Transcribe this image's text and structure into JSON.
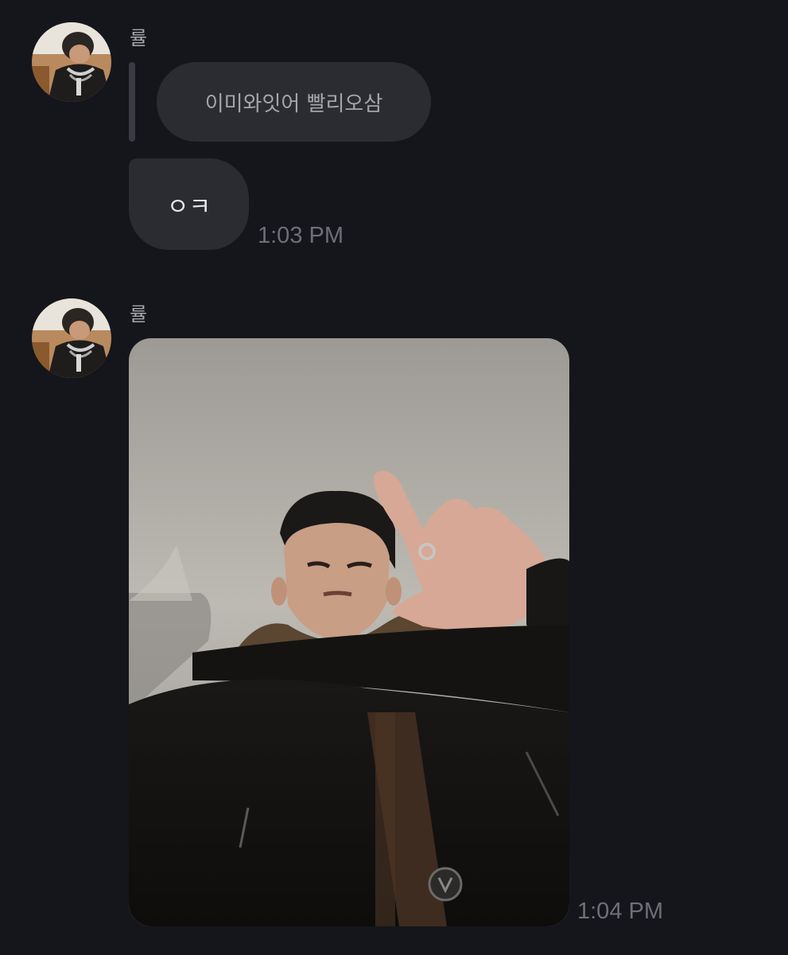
{
  "messages": [
    {
      "sender": "률",
      "avatar_icon": "profile-photo-avatar",
      "quoted_text": "이미와잇어 빨리오삼",
      "text": "ㅇㅋ",
      "time": "1:03 PM"
    },
    {
      "sender": "률",
      "avatar_icon": "profile-photo-avatar",
      "attachment": "photo",
      "time": "1:04 PM"
    }
  ],
  "colors": {
    "background": "#15161b",
    "bubble": "#2b2c32",
    "timestamp": "#6e6f76",
    "name": "#a7a8ae"
  }
}
